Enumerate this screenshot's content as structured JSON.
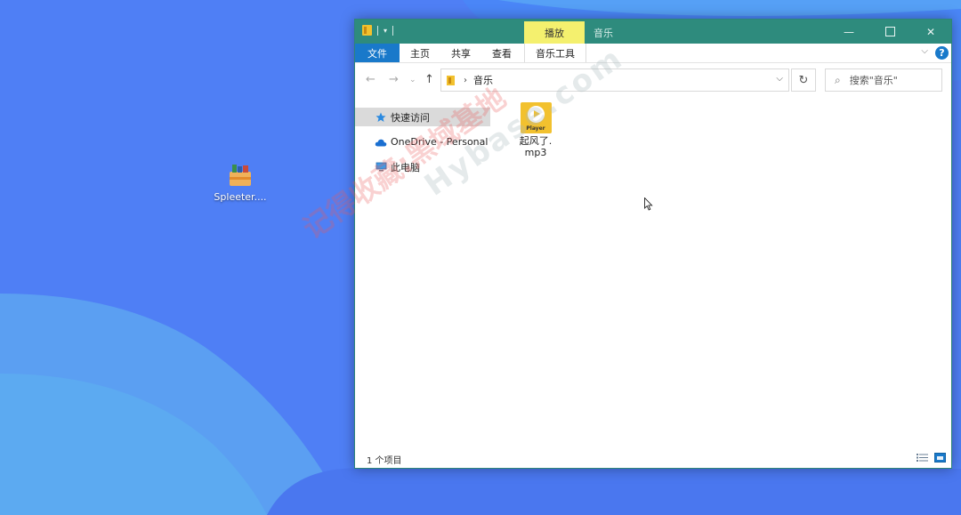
{
  "desktop": {
    "icon_label": "Spleeter....",
    "icon_name": "spleeter-app-icon"
  },
  "window": {
    "title": "音乐",
    "context_tab": "播放",
    "controls": {
      "minimize": "—",
      "close": "✕"
    }
  },
  "ribbon": {
    "tabs": [
      "文件",
      "主页",
      "共享",
      "查看",
      "音乐工具"
    ],
    "help": "?"
  },
  "navigation": {
    "back": "←",
    "forward": "→",
    "recent": "⌄",
    "up": "↑",
    "breadcrumb_separator": "›",
    "path_segment": "音乐",
    "refresh": "↻",
    "search_placeholder": "搜索\"音乐\""
  },
  "sidebar": {
    "items": [
      {
        "label": "快速访问",
        "icon": "star-icon",
        "selected": true
      },
      {
        "label": "OneDrive - Personal",
        "icon": "cloud-icon",
        "selected": false
      },
      {
        "label": "此电脑",
        "icon": "computer-icon",
        "selected": false
      }
    ]
  },
  "files": [
    {
      "name": "起风了.mp3",
      "name_line1": "起风了.",
      "name_line2": "mp3",
      "thumb_label": "Player"
    }
  ],
  "status": {
    "count": "1 个项目"
  },
  "watermark": {
    "line1": "记得收藏:黑域基地",
    "line2": "Hybase.com"
  },
  "colors": {
    "titlebar": "#2e8b7d",
    "context_tab": "#f4f06e",
    "file_tab": "#1979ca",
    "folder": "#f2c12e"
  }
}
